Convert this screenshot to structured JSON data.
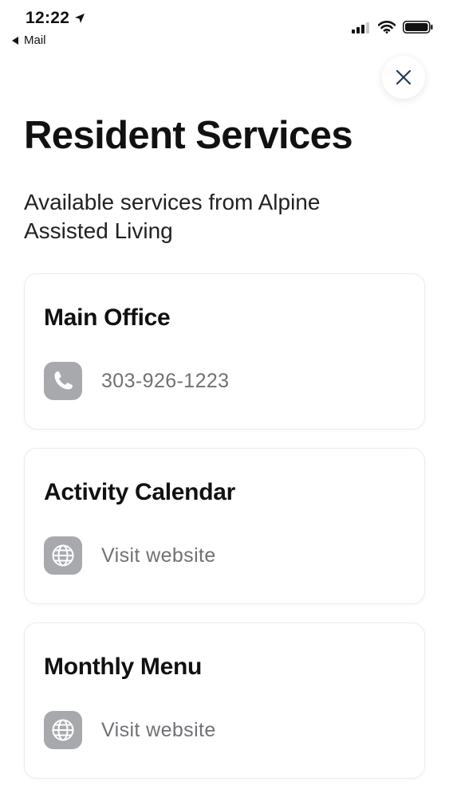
{
  "status_bar": {
    "time": "12:22",
    "back_label": "Mail"
  },
  "header": {
    "title": "Resident Services",
    "subtitle": "Available services from Alpine Assisted Living"
  },
  "cards": [
    {
      "title": "Main Office",
      "icon": "phone-icon",
      "text": "303-926-1223"
    },
    {
      "title": "Activity Calendar",
      "icon": "globe-icon",
      "text": "Visit website"
    },
    {
      "title": "Monthly Menu",
      "icon": "globe-icon",
      "text": "Visit website"
    }
  ],
  "colors": {
    "icon_tile": "#a7a9ad",
    "secondary_text": "#707175",
    "close_icon": "#1f3b57"
  }
}
